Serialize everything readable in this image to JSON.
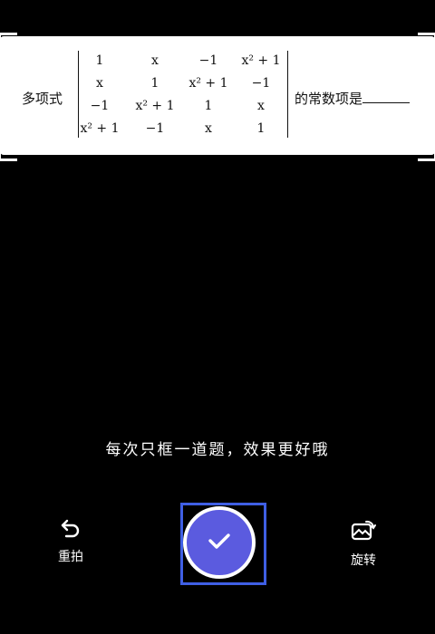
{
  "question": {
    "prefix": "多项式",
    "suffix": "的常数项是",
    "matrix": [
      [
        "1",
        "x",
        "−1",
        "x² + 1"
      ],
      [
        "x",
        "1",
        "x² + 1",
        "−1"
      ],
      [
        "−1",
        "x² + 1",
        "1",
        "x"
      ],
      [
        "x² + 1",
        "−1",
        "x",
        "1"
      ]
    ]
  },
  "hint": "每次只框一道题，效果更好哦",
  "controls": {
    "retake_label": "重拍",
    "rotate_label": "旋转"
  },
  "colors": {
    "accent": "#5b5bdf",
    "frame": "#3f5fe4",
    "background": "#000000"
  }
}
